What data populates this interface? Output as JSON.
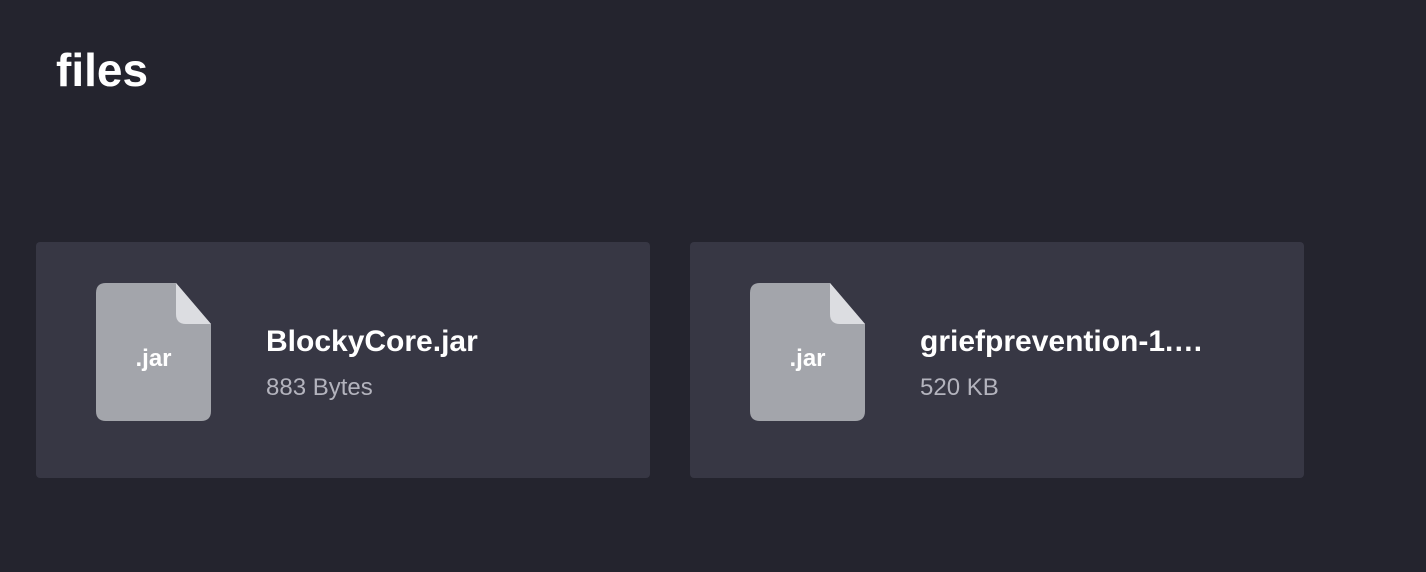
{
  "header": {
    "title": "files"
  },
  "files": [
    {
      "name": "BlockyCore.jar",
      "size": "883 Bytes",
      "ext": ".jar",
      "icon": "file-icon"
    },
    {
      "name": "griefprevention-1.1…",
      "size": "520 KB",
      "ext": ".jar",
      "icon": "file-icon"
    }
  ],
  "colors": {
    "background": "#24242e",
    "card": "#373744",
    "file_icon": "#a3a5ab",
    "file_icon_fold": "#dcdde1",
    "text_primary": "#ffffff",
    "text_secondary": "#b3b3bd"
  }
}
